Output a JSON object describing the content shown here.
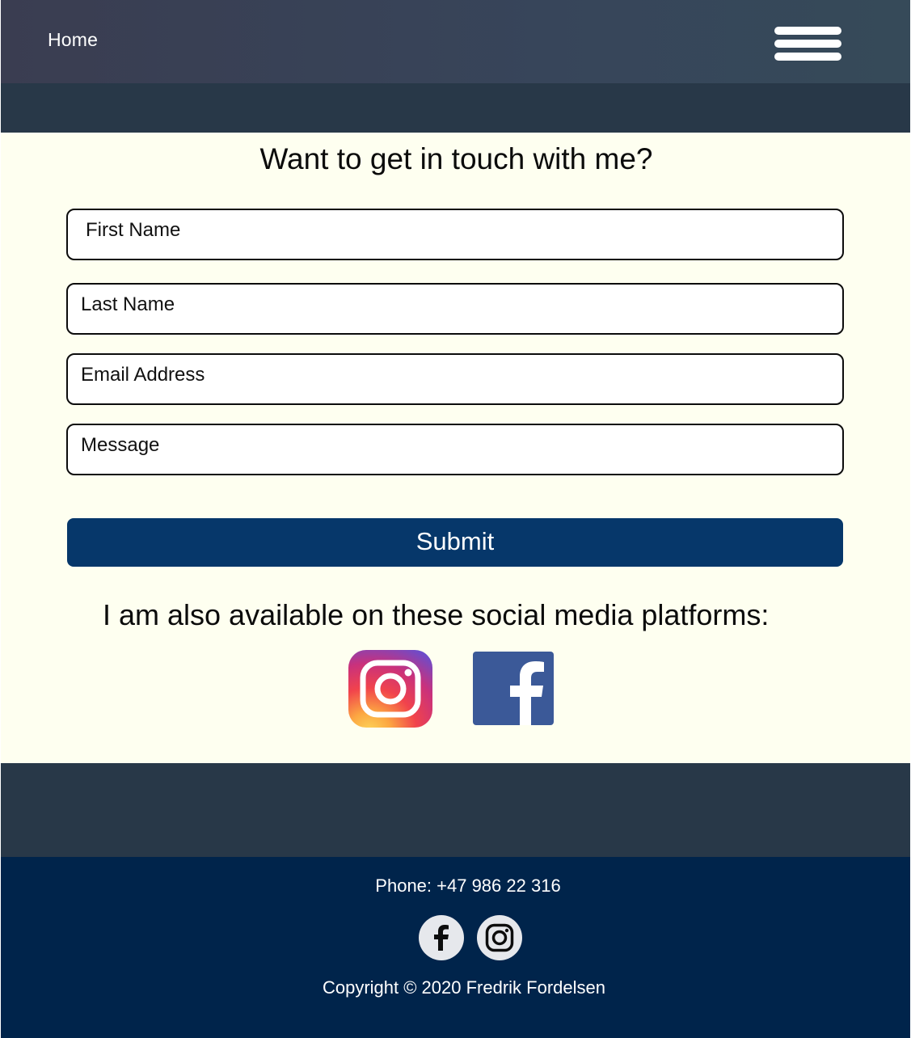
{
  "header": {
    "home_label": "Home",
    "menu_icon": "hamburger-menu-icon"
  },
  "contact": {
    "heading": "Want to get in touch with me?",
    "fields": [
      {
        "placeholder": "First Name"
      },
      {
        "placeholder": "Last Name"
      },
      {
        "placeholder": "Email Address"
      },
      {
        "placeholder": "Message"
      }
    ],
    "submit_label": "Submit"
  },
  "social": {
    "heading": "I am also available on these social media platforms:",
    "icons": [
      "instagram-icon",
      "facebook-icon"
    ]
  },
  "footer": {
    "phone": "Phone: +47 986 22 316",
    "icons": [
      "facebook-icon",
      "instagram-icon"
    ],
    "copyright": "Copyright © 2020 Fredrik Fordelsen"
  },
  "colors": {
    "header_bg": "#3a3d51",
    "band_bg": "#283848",
    "main_bg": "#fefff0",
    "submit_bg": "#06376a",
    "footer_bg": "#00244b",
    "facebook_blue": "#3b5998"
  }
}
